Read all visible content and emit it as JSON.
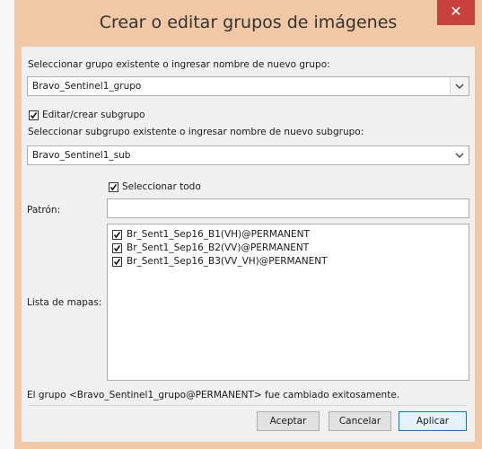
{
  "window": {
    "title": "Crear o editar grupos de imágenes",
    "close_glyph": "✕"
  },
  "group": {
    "label": "Seleccionar grupo existente o ingresar nombre de nuevo grupo:",
    "value": "Bravo_Sentinel1_grupo"
  },
  "subgroup": {
    "checkbox_label": "Editar/crear subgrupo",
    "checked": true,
    "label": "Seleccionar subgrupo existente o ingresar nombre de nuevo subgrupo:",
    "value": "Bravo_Sentinel1_sub"
  },
  "select_all": {
    "label": "Seleccionar todo",
    "checked": true
  },
  "pattern": {
    "label": "Patrón:",
    "value": ""
  },
  "maps": {
    "label": "Lista de mapas:",
    "items": [
      {
        "label": "Br_Sent1_Sep16_B1(VH)@PERMANENT",
        "checked": true
      },
      {
        "label": "Br_Sent1_Sep16_B2(VV)@PERMANENT",
        "checked": true
      },
      {
        "label": "Br_Sent1_Sep16_B3(VV_VH)@PERMANENT",
        "checked": true
      }
    ]
  },
  "status": "El grupo <Bravo_Sentinel1_grupo@PERMANENT> fue cambiado exitosamente.",
  "buttons": {
    "accept": "Aceptar",
    "cancel": "Cancelar",
    "apply": "Aplicar"
  },
  "colors": {
    "frame": "#f0c8a6",
    "close": "#c7423f",
    "primary_border": "#0078d7"
  }
}
